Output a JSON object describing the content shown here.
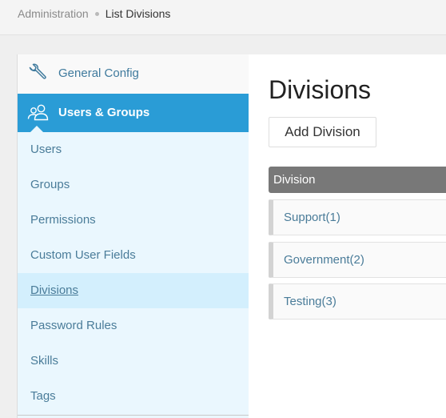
{
  "breadcrumb": {
    "parent": "Administration",
    "current": "List Divisions"
  },
  "sidebar": {
    "sections": [
      {
        "label": "General Config",
        "icon": "wrench-icon"
      },
      {
        "label": "Users & Groups",
        "icon": "users-icon",
        "active": true
      }
    ],
    "items": [
      {
        "label": "Users"
      },
      {
        "label": "Groups"
      },
      {
        "label": "Permissions"
      },
      {
        "label": "Custom User Fields"
      },
      {
        "label": "Divisions",
        "active": true
      },
      {
        "label": "Password Rules"
      },
      {
        "label": "Skills"
      },
      {
        "label": "Tags"
      }
    ]
  },
  "main": {
    "title": "Divisions",
    "add_button": "Add Division",
    "table": {
      "header": "Division",
      "rows": [
        {
          "label": "Support(1)"
        },
        {
          "label": "Government(2)"
        },
        {
          "label": "Testing(3)"
        }
      ]
    }
  },
  "colors": {
    "accent": "#2a9cd6",
    "link": "#4a7c99",
    "active_item_bg": "#d3effd",
    "sidebar_bg": "#eaf7fe",
    "table_header_bg": "#787878"
  }
}
